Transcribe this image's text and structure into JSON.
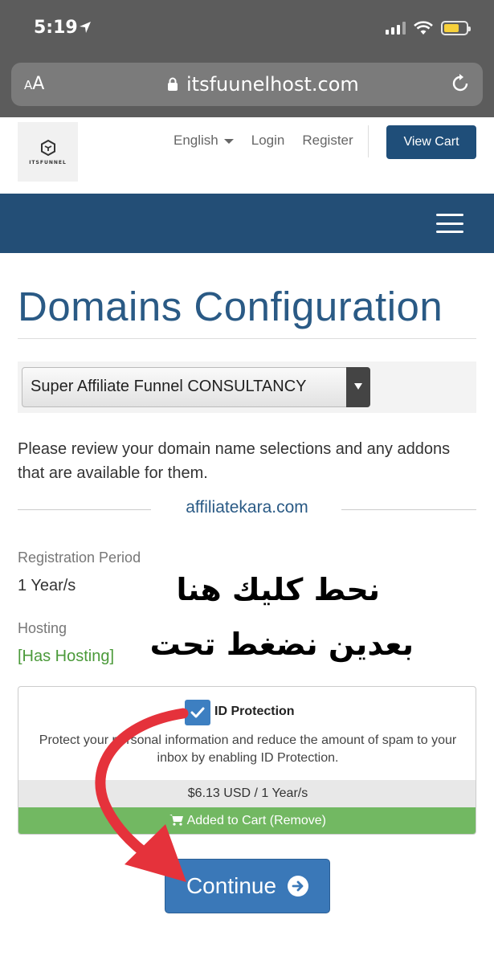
{
  "status_bar": {
    "time": "5:19"
  },
  "browser": {
    "text_size_label_small": "A",
    "text_size_label_large": "A",
    "url": "itsfuunelhost.com"
  },
  "header": {
    "logo_text": "ITSFUNNEL",
    "nav": {
      "language": "English",
      "login": "Login",
      "register": "Register",
      "view_cart": "View Cart"
    }
  },
  "main": {
    "title": "Domains Configuration",
    "product_select": {
      "selected": "Super Affiliate Funnel CONSULTANCY"
    },
    "intro": "Please review your domain name selections and any addons that are available for them.",
    "domain": "affiliatekara.com",
    "registration_period": {
      "label": "Registration Period",
      "value": "1 Year/s"
    },
    "hosting": {
      "label": "Hosting",
      "value": "[Has Hosting]"
    },
    "annotation": {
      "line1": "نحط كليك هنا",
      "line2": "بعدين نضغط تحت"
    },
    "addon": {
      "checked": true,
      "title": "ID Protection",
      "description": "Protect your personal information and reduce the amount of spam to your inbox by enabling ID Protection.",
      "price": "$6.13 USD / 1 Year/s",
      "status": "Added to Cart (Remove)"
    },
    "continue_label": "Continue"
  },
  "colors": {
    "brand_blue": "#234e76",
    "title_blue": "#2a5a85",
    "button_blue": "#3a78b8",
    "added_green": "#72b862",
    "hosting_green": "#4b9a3a",
    "annotation_red": "#e5323b"
  }
}
